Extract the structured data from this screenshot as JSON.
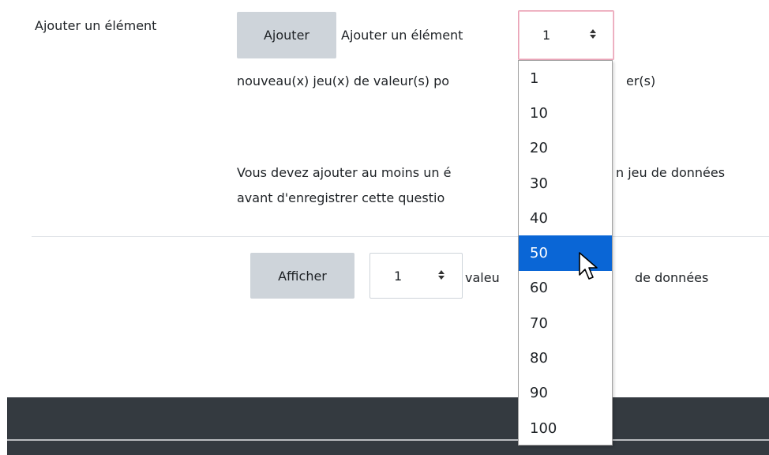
{
  "form": {
    "add_item_label": "Ajouter un élément",
    "add_button": "Ajouter",
    "add_item_text": "Ajouter un élément",
    "add_select_value": "1",
    "new_sets_text": "nouveau(x) jeu(x) de valeur(s) po",
    "new_sets_text_tail": "er(s)",
    "warning_line1": "Vous devez ajouter au moins un é",
    "warning_line1_tail": "n jeu de données",
    "warning_line2": "avant d'enregistrer cette questio",
    "show_button": "Afficher",
    "show_select_value": "1",
    "show_text": "valeu",
    "show_text_tail": "de données"
  },
  "dropdown": {
    "options": [
      "1",
      "10",
      "20",
      "30",
      "40",
      "50",
      "60",
      "70",
      "80",
      "90",
      "100"
    ],
    "highlighted": "50",
    "highlight_color": "#0a66d6"
  },
  "icons": {
    "select_arrows": "updown-arrows-icon",
    "cursor": "mouse-pointer-icon"
  }
}
